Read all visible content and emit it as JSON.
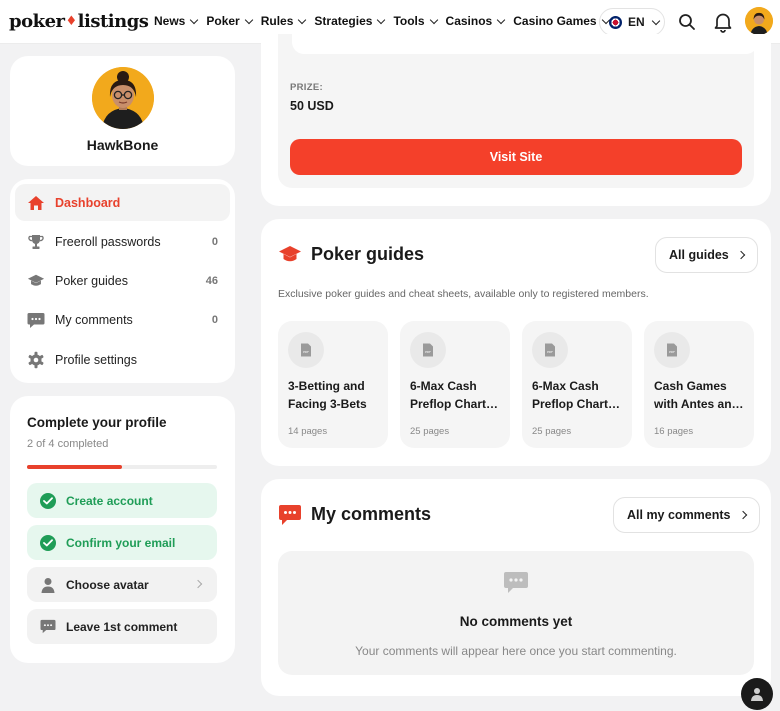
{
  "brand": {
    "logo_left": "poker",
    "logo_right": "listings",
    "accent": "#f4402a"
  },
  "nav": {
    "items": [
      "News",
      "Poker",
      "Rules",
      "Strategies",
      "Tools",
      "Casinos",
      "Casino Games"
    ],
    "language": "EN"
  },
  "profile": {
    "username": "HawkBone"
  },
  "menu": {
    "items": [
      {
        "label": "Dashboard",
        "icon": "home-icon",
        "count": ""
      },
      {
        "label": "Freeroll passwords",
        "icon": "trophy-icon",
        "count": "0"
      },
      {
        "label": "Poker guides",
        "icon": "graduation-cap-icon",
        "count": "46"
      },
      {
        "label": "My comments",
        "icon": "comment-icon",
        "count": "0"
      },
      {
        "label": "Profile settings",
        "icon": "gear-icon",
        "count": ""
      }
    ]
  },
  "complete_profile": {
    "title": "Complete your profile",
    "subtitle": "2 of 4 completed",
    "progress": 0.5,
    "tasks": [
      {
        "label": "Create account",
        "done": true
      },
      {
        "label": "Confirm your email",
        "done": true
      },
      {
        "label": "Choose avatar",
        "done": false
      },
      {
        "label": "Leave 1st comment",
        "done": false
      }
    ]
  },
  "prize": {
    "label": "PRIZE:",
    "value": "50 USD",
    "button": "Visit Site"
  },
  "guides": {
    "title": "Poker guides",
    "all_button": "All guides",
    "description": "Exclusive poker guides and cheat sheets, available only to registered members.",
    "items": [
      {
        "line1": "3-Betting and",
        "line2": "Facing 3-Bets",
        "pages": "14 pages"
      },
      {
        "line1": "6-Max Cash",
        "line2": "Preflop Chart…",
        "pages": "25 pages"
      },
      {
        "line1": "6-Max Cash",
        "line2": "Preflop Chart…",
        "pages": "25 pages"
      },
      {
        "line1": "Cash Games",
        "line2": "with Antes an…",
        "pages": "16 pages"
      }
    ]
  },
  "comments": {
    "title": "My comments",
    "all_button": "All my comments",
    "empty_title": "No comments yet",
    "empty_sub": "Your comments will appear here once you start commenting."
  }
}
